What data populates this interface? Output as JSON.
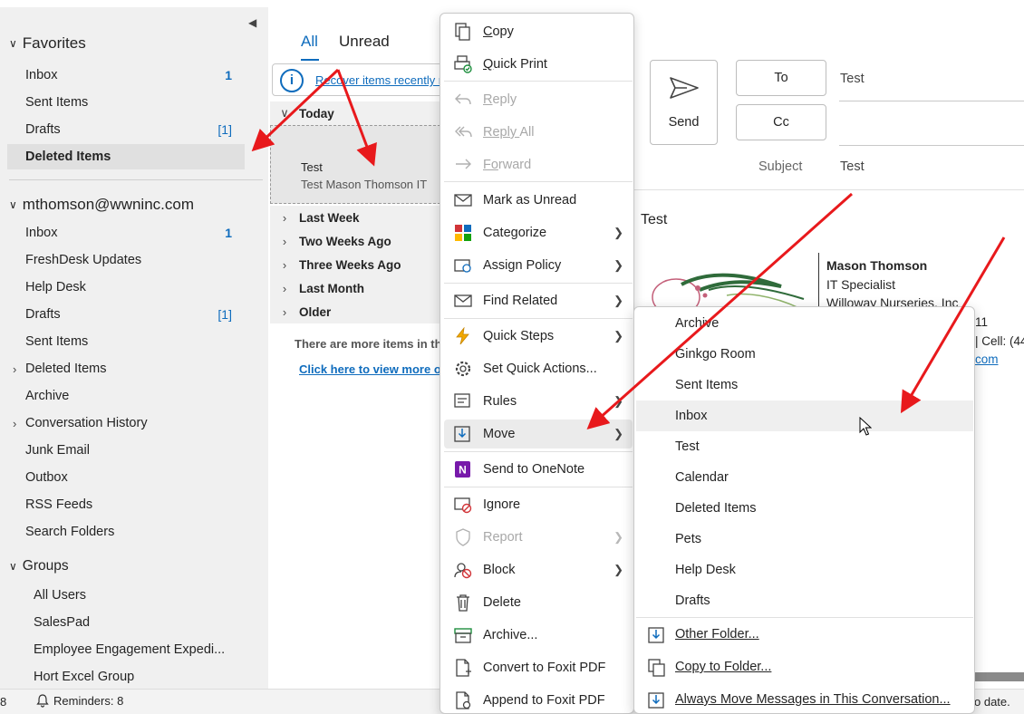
{
  "folder_pane": {
    "favorites_header": "Favorites",
    "favorites": [
      {
        "label": "Inbox",
        "count": "1"
      },
      {
        "label": "Sent Items",
        "count": ""
      },
      {
        "label": "Drafts",
        "count": "[1]"
      },
      {
        "label": "Deleted Items",
        "count": "",
        "selected": true
      }
    ],
    "account_header": "mthomson@wwninc.com",
    "account_folders": [
      {
        "label": "Inbox",
        "count": "1"
      },
      {
        "label": "FreshDesk Updates",
        "count": ""
      },
      {
        "label": "Help Desk",
        "count": ""
      },
      {
        "label": "Drafts",
        "count": "[1]"
      },
      {
        "label": "Sent Items",
        "count": ""
      },
      {
        "label": "Deleted Items",
        "count": "",
        "expandable": true
      },
      {
        "label": "Archive",
        "count": ""
      },
      {
        "label": "Conversation History",
        "count": "",
        "expandable": true
      },
      {
        "label": "Junk Email",
        "count": ""
      },
      {
        "label": "Outbox",
        "count": ""
      },
      {
        "label": "RSS Feeds",
        "count": ""
      },
      {
        "label": "Search Folders",
        "count": ""
      }
    ],
    "groups_header": "Groups",
    "groups": [
      "All Users",
      "SalesPad",
      "Employee Engagement Expedi...",
      "Hort Excel Group"
    ]
  },
  "message_list": {
    "tabs": [
      "All",
      "Unread"
    ],
    "info_link": "Recover items recently r",
    "groups": [
      "Today",
      "Last Week",
      "Two Weeks Ago",
      "Three Weeks Ago",
      "Last Month",
      "Older"
    ],
    "message": {
      "subject": "Test",
      "preview": "Test  Mason Thomson  IT"
    },
    "more_text": "There are more items in th",
    "more_link": "Click here to view more o"
  },
  "reading_pane": {
    "send_label": "Send",
    "to_label": "To",
    "to_value": "Test",
    "cc_label": "Cc",
    "subject_label": "Subject",
    "subject_value": "Test",
    "body_title": "Test",
    "signature": {
      "name": "Mason Thomson",
      "title": "IT Specialist",
      "company": "Willoway Nurseries, Inc",
      "phone_tail": "11",
      "cell_tail": "| Cell: (44",
      "link_tail": "com"
    }
  },
  "context_menu": {
    "items": [
      {
        "label": "Copy",
        "icon": "copy-icon",
        "u": "C",
        "rest": "opy"
      },
      {
        "label": "Quick Print",
        "icon": "print-icon",
        "u": "Q",
        "rest": "uick Print"
      },
      {
        "label": "Reply",
        "icon": "reply-icon",
        "u": "R",
        "rest": "eply",
        "disabled": true
      },
      {
        "label": "Reply All",
        "icon": "reply-all-icon",
        "u": "Reply ",
        "rest": "All",
        "disabled": true
      },
      {
        "label": "Forward",
        "icon": "forward-icon",
        "u": "Fo",
        "rest": "rward",
        "disabled": true
      },
      {
        "label": "Mark as Unread",
        "icon": "envelope-icon"
      },
      {
        "label": "Categorize",
        "icon": "categorize-icon",
        "submenu": true
      },
      {
        "label": "Assign Policy",
        "icon": "policy-icon",
        "submenu": true
      },
      {
        "label": "Find Related",
        "icon": "find-related-icon",
        "submenu": true
      },
      {
        "label": "Quick Steps",
        "icon": "lightning-icon",
        "submenu": true
      },
      {
        "label": "Set Quick Actions...",
        "icon": "gear-icon"
      },
      {
        "label": "Rules",
        "icon": "rules-icon",
        "submenu": true
      },
      {
        "label": "Move",
        "icon": "move-icon",
        "submenu": true,
        "hover": true
      },
      {
        "label": "Send to OneNote",
        "icon": "onenote-icon"
      },
      {
        "label": "Ignore",
        "icon": "ignore-icon"
      },
      {
        "label": "Report",
        "icon": "shield-icon",
        "submenu": true,
        "disabled": true
      },
      {
        "label": "Block",
        "icon": "block-icon",
        "submenu": true
      },
      {
        "label": "Delete",
        "icon": "trash-icon"
      },
      {
        "label": "Archive...",
        "icon": "archive-icon"
      },
      {
        "label": "Convert to Foxit PDF",
        "icon": "pdf-convert-icon"
      },
      {
        "label": "Append to Foxit PDF",
        "icon": "pdf-append-icon"
      }
    ]
  },
  "move_submenu": {
    "folders": [
      "Archive",
      "Ginkgo Room",
      "Sent Items",
      "Inbox",
      "Test",
      "Calendar",
      "Deleted Items",
      "Pets",
      "Help Desk",
      "Drafts"
    ],
    "hovered": "Inbox",
    "actions": [
      {
        "label": "Other Folder...",
        "icon": "move-folder-icon"
      },
      {
        "label": "Copy to Folder...",
        "icon": "copy-folder-icon"
      },
      {
        "label": "Always Move Messages in This Conversation...",
        "icon": "always-move-icon"
      }
    ]
  },
  "status_bar": {
    "left_number": "8",
    "reminders": "Reminders: 8",
    "right_text": "o date."
  },
  "colors": {
    "accent": "#0f6cbd",
    "arrow": "#e8191c",
    "selected_bg": "#e0e0e0"
  }
}
